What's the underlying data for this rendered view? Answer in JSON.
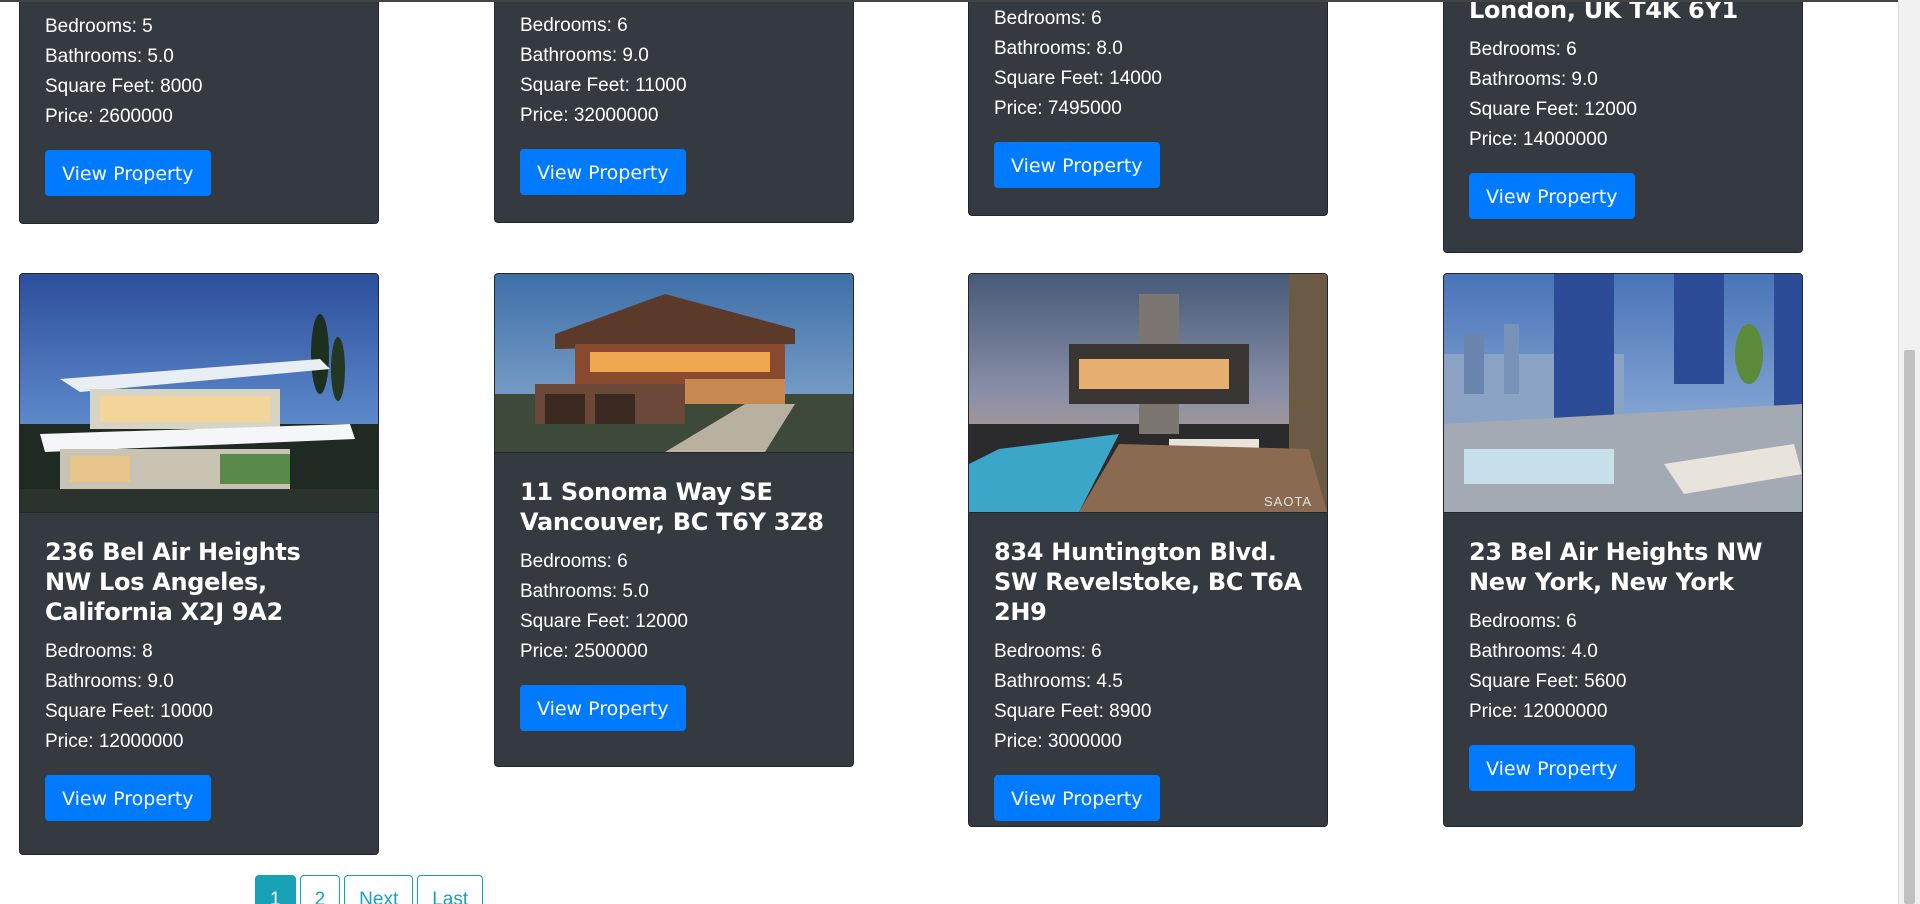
{
  "top_row": [
    {
      "bedrooms": "Bedrooms: 5",
      "bathrooms": "Bathrooms: 5.0",
      "sqft": "Square Feet: 8000",
      "price": "Price: 2600000",
      "button": "View Property"
    },
    {
      "bedrooms": "Bedrooms: 6",
      "bathrooms": "Bathrooms: 9.0",
      "sqft": "Square Feet: 11000",
      "price": "Price: 32000000",
      "button": "View Property"
    },
    {
      "bedrooms": "Bedrooms: 6",
      "bathrooms": "Bathrooms: 8.0",
      "sqft": "Square Feet: 14000",
      "price": "Price: 7495000",
      "button": "View Property"
    },
    {
      "title_tail": "London, UK T4K 6Y1",
      "bedrooms": "Bedrooms: 6",
      "bathrooms": "Bathrooms: 9.0",
      "sqft": "Square Feet: 12000",
      "price": "Price: 14000000",
      "button": "View Property"
    }
  ],
  "bottom_row": [
    {
      "title": "236 Bel Air Heights NW Los Angeles, California X2J 9A2",
      "bedrooms": "Bedrooms: 8",
      "bathrooms": "Bathrooms: 9.0",
      "sqft": "Square Feet: 10000",
      "price": "Price: 12000000",
      "button": "View Property"
    },
    {
      "title": "11 Sonoma Way SE Vancouver, BC T6Y 3Z8",
      "bedrooms": "Bedrooms: 6",
      "bathrooms": "Bathrooms: 5.0",
      "sqft": "Square Feet: 12000",
      "price": "Price: 2500000",
      "button": "View Property"
    },
    {
      "title": "834 Huntington Blvd. SW Revelstoke, BC T6A 2H9",
      "image_watermark": "SAOTA",
      "bedrooms": "Bedrooms: 6",
      "bathrooms": "Bathrooms: 4.5",
      "sqft": "Square Feet: 8900",
      "price": "Price: 3000000",
      "button": "View Property"
    },
    {
      "title": "23 Bel Air Heights NW New York, New York",
      "bedrooms": "Bedrooms: 6",
      "bathrooms": "Bathrooms: 4.0",
      "sqft": "Square Feet: 5600",
      "price": "Price: 12000000",
      "button": "View Property"
    }
  ],
  "pagination": {
    "page1": "1",
    "page2": "2",
    "next": "Next",
    "last": "Last"
  },
  "colors": {
    "card_bg": "#343a40",
    "button_bg": "#007bff",
    "pagination_accent": "#17a2b8"
  }
}
